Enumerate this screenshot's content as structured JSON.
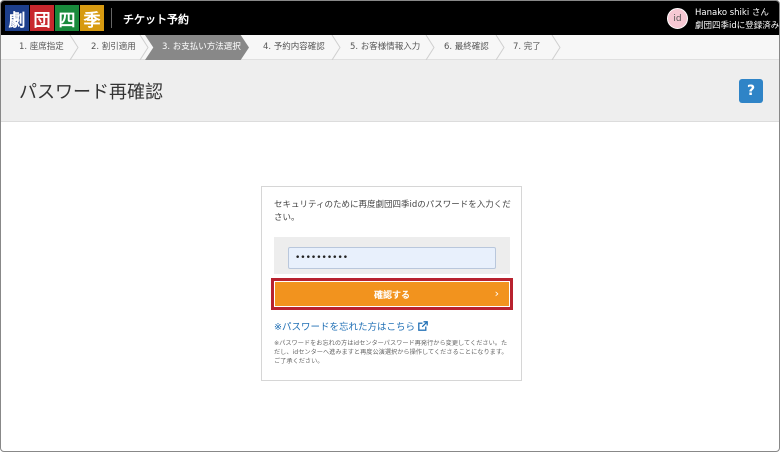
{
  "header": {
    "logo_chars": [
      "劇",
      "団",
      "四",
      "季"
    ],
    "app_title": "チケット予約",
    "avatar_label": "id",
    "user_name": "Hanako shiki さん",
    "user_status": "劇団四季idに登録済み"
  },
  "steps": [
    {
      "label": "1. 座席指定",
      "active": false
    },
    {
      "label": "2. 割引適用",
      "active": false
    },
    {
      "label": "3. お支払い方法選択",
      "active": true
    },
    {
      "label": "4. 予約内容確認",
      "active": false
    },
    {
      "label": "5. お客様情報入力",
      "active": false
    },
    {
      "label": "6. 最終確認",
      "active": false
    },
    {
      "label": "7. 完了",
      "active": false
    }
  ],
  "page": {
    "title": "パスワード再確認",
    "help_label": "?"
  },
  "card": {
    "message": "セキュリティのために再度劇団四季idのパスワードを入力ください。",
    "password_value": "••••••••••",
    "confirm_label": "確認する",
    "confirm_arrow": "›",
    "forgot_link": "※パスワードを忘れた方はこちら",
    "note": "※パスワードをお忘れの方はidセンターパスワード再発行から変更してください。ただし、idセンターへ進みますと再度公演選択から操作してくださることになります。ご了承ください。"
  },
  "colors": {
    "header_bg": "#000000",
    "active_step_bg": "#888888",
    "confirm_button": "#f2931e",
    "highlight_border": "#b8222f",
    "help_button": "#2f84c7",
    "link": "#1f6fb5"
  }
}
